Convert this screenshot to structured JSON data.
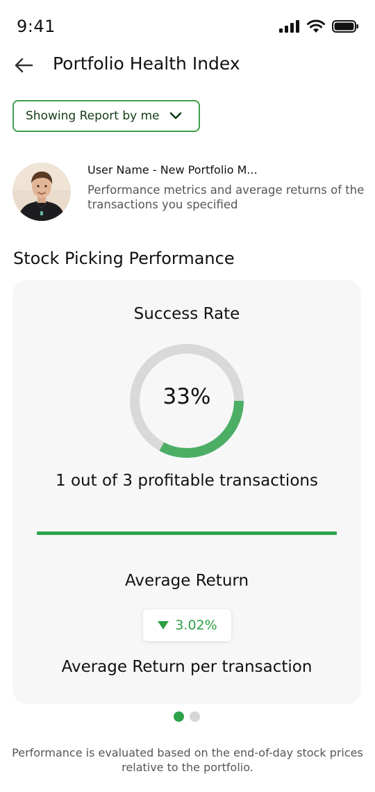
{
  "status_bar": {
    "time": "9:41",
    "icons": [
      "signal-icon",
      "wifi-icon",
      "battery-icon"
    ]
  },
  "header": {
    "title": "Portfolio Health Index",
    "back_icon": "arrow-left-icon"
  },
  "report_dropdown": {
    "label": "Showing Report by me",
    "icon": "chevron-down-icon",
    "accent_color": "#3aa04b"
  },
  "profile": {
    "user_name": "User Name - New Portfolio M...",
    "description": "Performance metrics and average returns of the transactions you specified"
  },
  "section": {
    "title": "Stock Picking Performance"
  },
  "card": {
    "success_label": "Success Rate",
    "success_rate_text": "33%",
    "success_rate_fraction": 0.33,
    "profitable_text": "1 out of 3 profitable transactions",
    "average_return_label": "Average Return",
    "average_return_value": "3.02%",
    "average_return_icon": "triangle-down-icon",
    "average_return_caption": "Average Return per transaction",
    "accent_color": "#2fa24a",
    "track_color": "#d9d9d9"
  },
  "pagination": {
    "count": 2,
    "active_index": 0
  },
  "footer": {
    "text": "Performance is evaluated based on the end-of-day stock prices relative to the portfolio."
  }
}
